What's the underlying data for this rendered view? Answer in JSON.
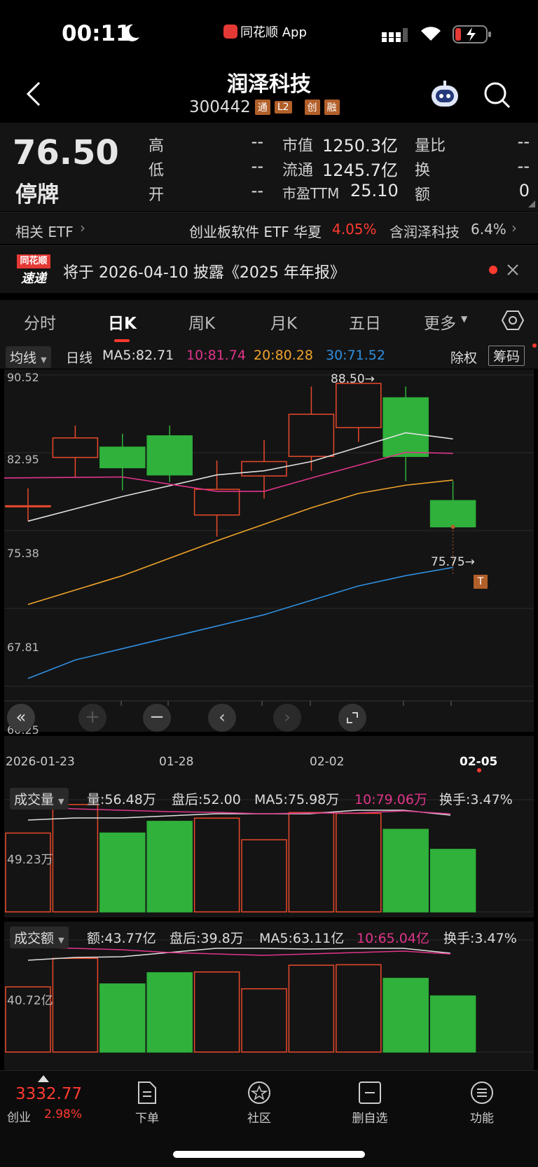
{
  "status": {
    "time": "00:11",
    "app_label": "同花顺 App"
  },
  "header": {
    "stock_name": "润泽科技",
    "stock_code": "300442",
    "tags": [
      "通",
      "L2",
      "创",
      "融"
    ]
  },
  "quote": {
    "price": "76.50",
    "status": "停牌",
    "rows": [
      [
        {
          "l": "高",
          "v": "--"
        },
        {
          "l": "市值",
          "v": "1250.3亿"
        },
        {
          "l": "量比",
          "v": "--"
        }
      ],
      [
        {
          "l": "低",
          "v": "--"
        },
        {
          "l": "流通",
          "v": "1245.7亿"
        },
        {
          "l": "换",
          "v": "--"
        }
      ],
      [
        {
          "l": "开",
          "v": "--"
        },
        {
          "l": "市盈TTM",
          "v": "25.10"
        },
        {
          "l": "额",
          "v": "0"
        }
      ]
    ]
  },
  "etf": {
    "label": "相关 ETF",
    "name": "创业板软件 ETF 华夏",
    "change": "4.05%",
    "holding": "含润泽科技",
    "pct": "6.4%"
  },
  "news": {
    "logo_top": "同花顺",
    "logo_bottom": "速递",
    "text": "将于 2026-04-10 披露《2025 年年报》"
  },
  "tabs": [
    "分时",
    "日K",
    "周K",
    "月K",
    "五日",
    "更多"
  ],
  "ma": {
    "mode": "均线",
    "period": "日线",
    "ma5": "MA5:82.71",
    "ma10": "10:81.74",
    "ma20": "20:80.28",
    "ma30": "30:71.52",
    "adjust": "除权",
    "chips": "筹码"
  },
  "colors": {
    "up": "#e8492b",
    "down": "#2fb13b",
    "ma5": "#e0e0e0",
    "ma10": "#e0358a",
    "ma20": "#f0a32a",
    "ma30": "#2f8fe0",
    "accent": "#ff3a2f"
  },
  "chart_data": {
    "type": "candlestick",
    "y_ticks": [
      "90.52",
      "82.95",
      "75.38",
      "67.81",
      "60.25"
    ],
    "ylim": [
      60.25,
      90.52
    ],
    "x_labels": [
      "2026-01-23",
      "01-28",
      "02-02",
      "02-05"
    ],
    "annotations": {
      "high": "88.50→",
      "low": "75.75→",
      "marker": "T"
    },
    "candles": [
      {
        "o": 77.8,
        "c": 77.8,
        "h": 79.5,
        "l": 76.3
      },
      {
        "o": 82.5,
        "c": 84.4,
        "h": 85.6,
        "l": 80.6
      },
      {
        "o": 83.5,
        "c": 81.5,
        "h": 84.8,
        "l": 79.3
      },
      {
        "o": 84.6,
        "c": 80.8,
        "h": 85.6,
        "l": 80.1
      },
      {
        "o": 76.9,
        "c": 79.4,
        "h": 82.2,
        "l": 74.8
      },
      {
        "o": 80.7,
        "c": 82.1,
        "h": 84.2,
        "l": 78.5
      },
      {
        "o": 82.6,
        "c": 86.7,
        "h": 89.4,
        "l": 81.2
      },
      {
        "o": 85.4,
        "c": 89.7,
        "h": 89.7,
        "l": 84.0
      },
      {
        "o": 88.3,
        "c": 82.6,
        "h": 89.4,
        "l": 80.2
      },
      {
        "o": 78.3,
        "c": 75.75,
        "h": 80.2,
        "l": 75.75
      }
    ],
    "ma5": [
      76.3,
      null,
      78.7,
      null,
      80.8,
      81.2,
      82.1,
      null,
      84.9,
      84.3
    ],
    "ma10": [
      80.5,
      null,
      80.6,
      null,
      79.2,
      79.2,
      80.5,
      null,
      83.0,
      82.9
    ],
    "ma20": [
      null,
      68.2,
      null,
      null,
      null,
      null,
      null,
      null,
      null,
      79.9
    ],
    "ma30": [
      null,
      null,
      null,
      null,
      null,
      null,
      null,
      null,
      null,
      71.4
    ]
  },
  "vol": {
    "label": "成交量",
    "q": "量:56.48万",
    "after": "盘后:52.00",
    "ma5": "MA5:75.98万",
    "ma10": "10:79.06万",
    "turnover": "换手:3.47%",
    "axis": "49.23万",
    "values": [
      49.2,
      67.0,
      49.2,
      56.5,
      58.5,
      45.0,
      62.0,
      61.5,
      51.5,
      39.0
    ]
  },
  "amt": {
    "label": "成交额",
    "q": "额:43.77亿",
    "after": "盘后:39.8万",
    "ma5": "MA5:63.11亿",
    "ma10": "10:65.04亿",
    "turnover": "换手:3.47%",
    "axis": "40.72亿",
    "values": [
      40.7,
      58.5,
      42.5,
      49.5,
      50.0,
      39.5,
      54.2,
      54.5,
      46.0,
      35.0
    ]
  },
  "bottom": {
    "index_value": "3332.77",
    "index_name": "创业",
    "index_change": "2.98%",
    "nav": [
      "下单",
      "社区",
      "删自选",
      "功能"
    ]
  }
}
